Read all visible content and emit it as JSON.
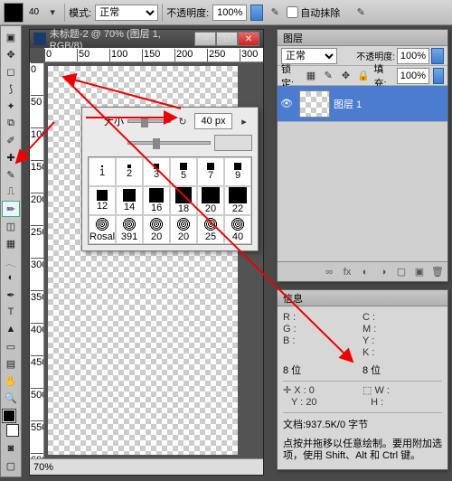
{
  "optbar": {
    "size_small": "40",
    "mode_label": "模式:",
    "mode_value": "正常",
    "opacity_label": "不透明度:",
    "opacity_value": "100%",
    "autoerase_label": "自动抹除"
  },
  "doc": {
    "title": "未标题-2 @ 70% (图层 1, RGB/8)",
    "zoom": "70%",
    "ruler_h": [
      "0",
      "50",
      "100",
      "150",
      "200",
      "250",
      "300"
    ],
    "ruler_v": [
      "0",
      "50",
      "100",
      "150",
      "200",
      "250",
      "300",
      "350",
      "400",
      "450",
      "500",
      "550",
      "600"
    ]
  },
  "brushpop": {
    "size_label": "大小",
    "size_value": "40 px",
    "presets": [
      {
        "s": 1,
        "l": "1"
      },
      {
        "s": 2,
        "l": "2"
      },
      {
        "s": 3,
        "l": "3"
      },
      {
        "s": 5,
        "l": "5"
      },
      {
        "s": 7,
        "l": "7"
      },
      {
        "s": 9,
        "l": "9"
      },
      {
        "s": 12,
        "l": "12"
      },
      {
        "s": 14,
        "l": "14"
      },
      {
        "s": 16,
        "l": "16"
      },
      {
        "s": 18,
        "l": "18"
      },
      {
        "s": 20,
        "l": "20"
      },
      {
        "s": 22,
        "l": "22"
      },
      {
        "s": 14,
        "l": "Rosal"
      },
      {
        "s": 16,
        "l": "391"
      },
      {
        "s": 18,
        "l": "20"
      },
      {
        "s": 18,
        "l": "20"
      },
      {
        "s": 18,
        "l": "25"
      },
      {
        "s": 18,
        "l": "40"
      }
    ]
  },
  "layers": {
    "tab": "图层",
    "blend": "正常",
    "opacity_label": "不透明度:",
    "opacity_value": "100%",
    "lock_label": "锁定:",
    "fill_label": "填充:",
    "fill_value": "100%",
    "items": [
      {
        "name": "图层 1",
        "visible": true,
        "selected": true
      }
    ]
  },
  "info": {
    "tab": "信息",
    "r": "R :",
    "g": "G :",
    "b": "B :",
    "c": "C :",
    "m": "M :",
    "y": "Y :",
    "k": "K :",
    "bits": "8 位",
    "bits2": "8 位",
    "x": "X :",
    "w": "W :",
    "h": "H :",
    "xv": "0",
    "yv": "20",
    "docsize": "文档:937.5K/0 字节",
    "hint": "点按并拖移以任意绘制。要用附加选项，使用 Shift、Alt 和 Ctrl 键。"
  }
}
